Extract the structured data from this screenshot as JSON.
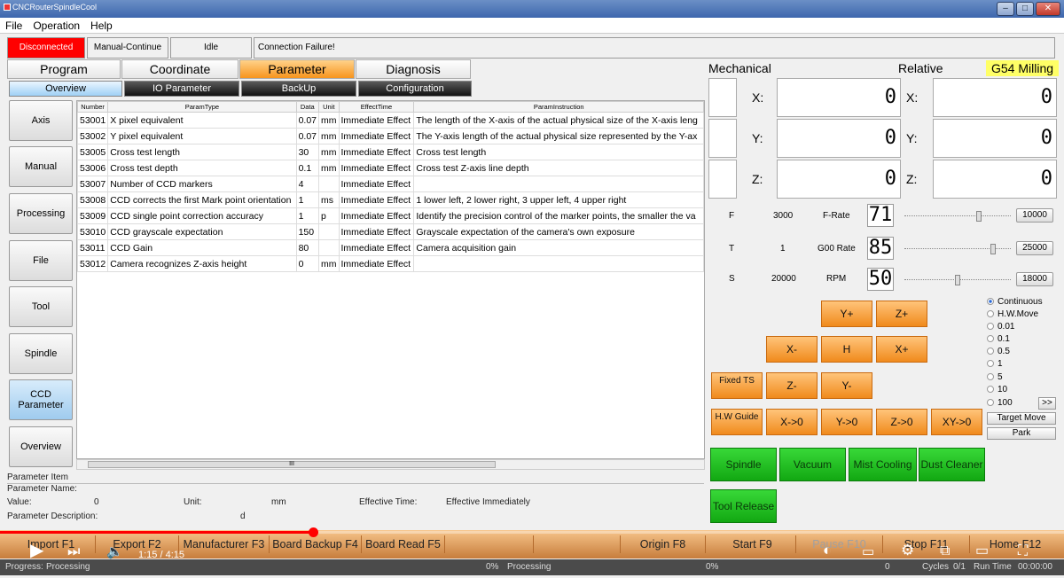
{
  "window": {
    "title": "CNCRouterSpindleCool"
  },
  "menu": [
    "File",
    "Operation",
    "Help"
  ],
  "status": {
    "connection": "Disconnected",
    "mode": "Manual-Continue",
    "state": "Idle",
    "message": "Connection Failure!"
  },
  "main_tabs": [
    "Program",
    "Coordinate",
    "Parameter",
    "Diagnosis"
  ],
  "sub_tabs": [
    "Overview",
    "IO Parameter",
    "BackUp",
    "Configuration"
  ],
  "side_buttons": [
    "Axis",
    "Manual",
    "Processing",
    "File",
    "Tool",
    "Spindle",
    "CCD Parameter",
    "Overview"
  ],
  "table": {
    "headers": [
      "Number",
      "ParamType",
      "Data",
      "Unit",
      "EffectTime",
      "ParamInstruction"
    ],
    "rows": [
      [
        "53001",
        "X pixel equivalent",
        "0.07",
        "mm",
        "Immediate Effect",
        "The length of the X-axis of the actual physical size of the X-axis leng"
      ],
      [
        "53002",
        "Y pixel equivalent",
        "0.07",
        "mm",
        "Immediate Effect",
        "The Y-axis length of the actual physical size represented by the Y-ax"
      ],
      [
        "53005",
        "Cross test length",
        "30",
        "mm",
        "Immediate Effect",
        "Cross test length"
      ],
      [
        "53006",
        "Cross test depth",
        "0.1",
        "mm",
        "Immediate Effect",
        "Cross test Z-axis line depth"
      ],
      [
        "53007",
        "Number of CCD markers",
        "4",
        "",
        "Immediate Effect",
        ""
      ],
      [
        "53008",
        "CCD corrects the first Mark point orientation",
        "1",
        "ms",
        "Immediate Effect",
        "1 lower left, 2 lower right, 3 upper left, 4 upper right"
      ],
      [
        "53009",
        "CCD single point correction accuracy",
        "1",
        "p",
        "Immediate Effect",
        "Identify the precision control of the marker points, the smaller the va"
      ],
      [
        "53010",
        "CCD grayscale expectation",
        "150",
        "",
        "Immediate Effect",
        "Grayscale expectation of the camera's own exposure"
      ],
      [
        "53011",
        "CCD Gain",
        "80",
        "",
        "Immediate Effect",
        "Camera acquisition gain"
      ],
      [
        "53012",
        "Camera recognizes Z-axis height",
        "0",
        "mm",
        "Immediate Effect",
        ""
      ]
    ]
  },
  "param_info": {
    "item_label": "Parameter Item",
    "name_label": "Parameter Name:",
    "value_label": "Value:",
    "value": "0",
    "unit_label": "Unit:",
    "unit": "mm",
    "effective_label": "Effective Time:",
    "effective": "Effective Immediately",
    "desc_label": "Parameter Description:",
    "desc": "d"
  },
  "coords": {
    "mechanical_label": "Mechanical",
    "relative_label": "Relative",
    "mode_label": "G54 Milling",
    "axes": [
      {
        "label": "X:",
        "mech": "0",
        "rel_label": "X:",
        "rel": "0"
      },
      {
        "label": "Y:",
        "mech": "0",
        "rel_label": "Y:",
        "rel": "0"
      },
      {
        "label": "Z:",
        "mech": "0",
        "rel_label": "Z:",
        "rel": "0"
      }
    ]
  },
  "overrides": [
    {
      "key": "F",
      "value": "3000",
      "name": "F-Rate",
      "pct": "71",
      "max": "10000",
      "level": 0.71
    },
    {
      "key": "T",
      "value": "1",
      "name": "G00 Rate",
      "pct": "85",
      "max": "25000",
      "level": 0.85
    },
    {
      "key": "S",
      "value": "20000",
      "name": "RPM",
      "pct": "50",
      "max": "18000",
      "level": 0.5
    }
  ],
  "jog": {
    "yplus": "Y+",
    "zplus": "Z+",
    "xminus": "X-",
    "home": "H",
    "xplus": "X+",
    "fixed_ts": "Fixed TS",
    "zminus": "Z-",
    "yminus": "Y-",
    "hw_guide": "H.W Guide",
    "x0": "X->0",
    "y0": "Y->0",
    "z0": "Z->0",
    "xy0": "XY->0"
  },
  "step_options": [
    "Continuous",
    "H.W.Move",
    "0.01",
    "0.1",
    "0.5",
    "1",
    "5",
    "10",
    "100"
  ],
  "step_more": ">>",
  "target_move": "Target Move",
  "park": "Park",
  "outputs": [
    "Spindle",
    "Vacuum",
    "Mist Cooling",
    "Dust Cleaner"
  ],
  "tool_release": "Tool Release",
  "fkeys": [
    "Import F1",
    "Export F2",
    "Manufacturer F3",
    "Board Backup F4",
    "Board Read F5",
    "",
    "",
    "Origin F8",
    "Start F9",
    "Pause F10",
    "Stop F11",
    "Home F12"
  ],
  "progress": {
    "label": "Progress:",
    "state": "Processing",
    "pct1": "0%",
    "state2": "Processing",
    "pct2": "0%",
    "cycles_count": "0",
    "cycles_label": "Cycles",
    "cycles_frac": "0/1",
    "runtime_label": "Run Time",
    "runtime": "00:00:00"
  },
  "video": {
    "time": "1:15 / 4:15",
    "played_fraction": 0.294
  }
}
